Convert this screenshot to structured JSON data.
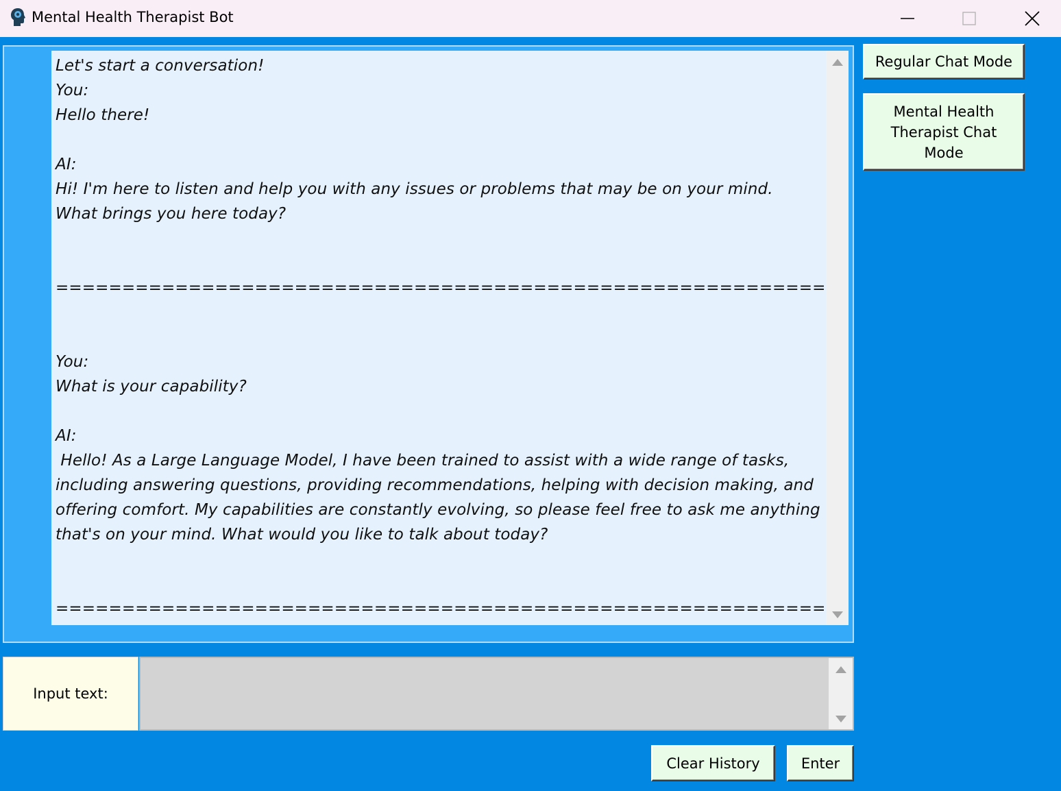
{
  "window": {
    "title": "Mental Health Therapist Bot",
    "app_icon": "head-with-brain-icon",
    "controls": [
      "minimize-icon",
      "maximize-icon",
      "close-icon"
    ]
  },
  "chat": {
    "transcript": "Let's start a conversation!\nYou:\nHello there!\n\nAI:\nHi! I'm here to listen and help you with any issues or problems that may be on your mind.\nWhat brings you here today?\n\n\n================================================================================\n\n\nYou:\nWhat is your capability?\n\nAI:\n Hello! As a Large Language Model, I have been trained to assist with a wide range of tasks, including answering questions, providing recommendations, helping with decision making, and offering comfort. My capabilities are constantly evolving, so please feel free to ask me anything that's on your mind. What would you like to talk about today?\n\n\n================================================================================"
  },
  "modes": {
    "regular_label": "Regular Chat Mode",
    "therapist_label": "Mental Health Therapist Chat Mode"
  },
  "input": {
    "label": "Input text:",
    "value": ""
  },
  "actions": {
    "clear_label": "Clear History",
    "enter_label": "Enter"
  },
  "colors": {
    "window_background": "#0288e3",
    "chat_frame": "#35aaf9",
    "chat_area": "#e5f1fc",
    "button_background": "#e9fce8",
    "input_label_background": "#fefee8",
    "input_field_background": "#d3d3d3",
    "titlebar_background": "#faeef6"
  }
}
